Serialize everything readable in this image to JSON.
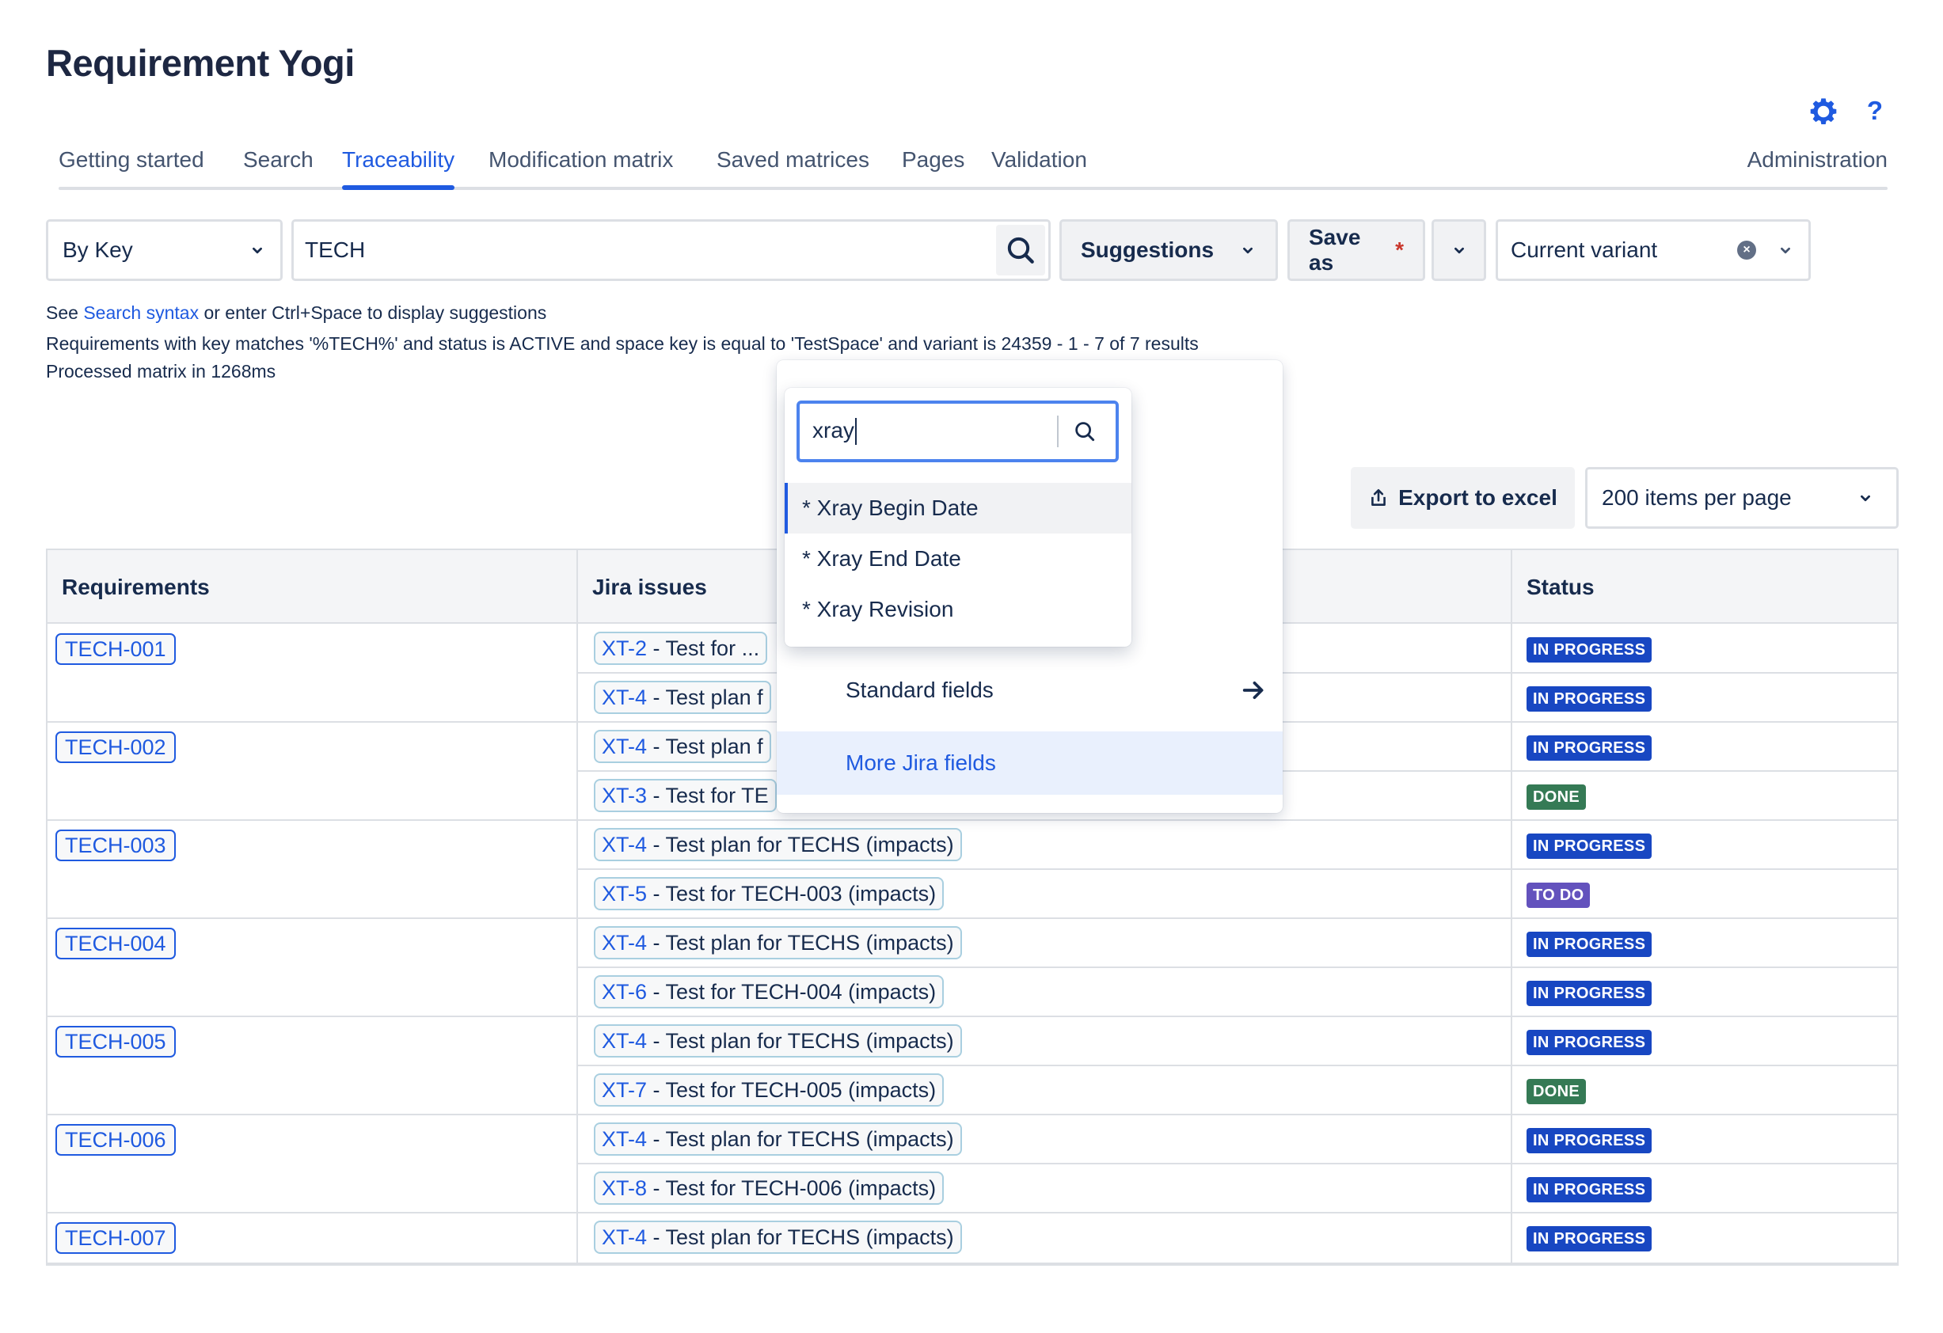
{
  "app": {
    "title": "Requirement Yogi"
  },
  "header_icons": {
    "settings": "gear-icon",
    "help": "?"
  },
  "tabs": [
    {
      "label": "Getting started",
      "active": false
    },
    {
      "label": "Search",
      "active": false
    },
    {
      "label": "Traceability",
      "active": true
    },
    {
      "label": "Modification matrix",
      "active": false
    },
    {
      "label": "Saved matrices",
      "active": false
    },
    {
      "label": "Pages",
      "active": false
    },
    {
      "label": "Validation",
      "active": false
    }
  ],
  "admin_tab": {
    "label": "Administration"
  },
  "controls": {
    "mode_select": "By Key",
    "query": "TECH",
    "suggestions_label": "Suggestions",
    "save_as_label": "Save as",
    "save_as_required_mark": "*",
    "variant_select": "Current variant"
  },
  "info": {
    "hint_prefix": "See ",
    "hint_link": "Search syntax",
    "hint_suffix": " or enter Ctrl+Space to display suggestions",
    "query_description": "Requirements with key matches '%TECH%' and status is ACTIVE and space key is equal to 'TestSpace' and variant is 24359 - 1 - 7 of 7 results",
    "processing": "Processed matrix in 1268ms"
  },
  "toolbar": {
    "export_label": "Export to excel",
    "per_page": "200 items per page"
  },
  "table": {
    "columns": [
      "Requirements",
      "Jira issues",
      "Status"
    ],
    "rows": [
      {
        "requirement": "TECH-001",
        "issue_key": "XT-2",
        "issue_summary": " - Test for ...",
        "status": "IN PROGRESS"
      },
      {
        "requirement": "",
        "issue_key": "XT-4",
        "issue_summary": " - Test plan f",
        "status": "IN PROGRESS"
      },
      {
        "requirement": "TECH-002",
        "issue_key": "XT-4",
        "issue_summary": " - Test plan f",
        "status": "IN PROGRESS"
      },
      {
        "requirement": "",
        "issue_key": "XT-3",
        "issue_summary": " - Test for TE",
        "status": "DONE"
      },
      {
        "requirement": "TECH-003",
        "issue_key": "XT-4",
        "issue_summary": " - Test plan for TECHS (impacts)",
        "status": "IN PROGRESS"
      },
      {
        "requirement": "",
        "issue_key": "XT-5",
        "issue_summary": " - Test for TECH-003 (impacts)",
        "status": "TO DO"
      },
      {
        "requirement": "TECH-004",
        "issue_key": "XT-4",
        "issue_summary": " - Test plan for TECHS (impacts)",
        "status": "IN PROGRESS"
      },
      {
        "requirement": "",
        "issue_key": "XT-6",
        "issue_summary": " - Test for TECH-004 (impacts)",
        "status": "IN PROGRESS"
      },
      {
        "requirement": "TECH-005",
        "issue_key": "XT-4",
        "issue_summary": " - Test plan for TECHS (impacts)",
        "status": "IN PROGRESS"
      },
      {
        "requirement": "",
        "issue_key": "XT-7",
        "issue_summary": " - Test for TECH-005 (impacts)",
        "status": "DONE"
      },
      {
        "requirement": "TECH-006",
        "issue_key": "XT-4",
        "issue_summary": " - Test plan for TECHS (impacts)",
        "status": "IN PROGRESS"
      },
      {
        "requirement": "",
        "issue_key": "XT-8",
        "issue_summary": " - Test for TECH-006 (impacts)",
        "status": "IN PROGRESS"
      },
      {
        "requirement": "TECH-007",
        "issue_key": "XT-4",
        "issue_summary": " - Test plan for TECHS (impacts)",
        "status": "IN PROGRESS"
      }
    ]
  },
  "status_colors": {
    "IN PROGRESS": "#1847c2",
    "DONE": "#357a55",
    "TO DO": "#6352bd"
  },
  "popover": {
    "search_value": "xray",
    "options": [
      {
        "label": "* Xray Begin Date",
        "highlighted": true
      },
      {
        "label": "* Xray End Date",
        "highlighted": false
      },
      {
        "label": "* Xray Revision",
        "highlighted": false
      }
    ],
    "standard_fields_label": "Standard fields",
    "more_fields_label": "More Jira fields"
  },
  "colors": {
    "accent": "#1f5ae0",
    "text": "#172b4d",
    "border": "#dcdfe4"
  }
}
